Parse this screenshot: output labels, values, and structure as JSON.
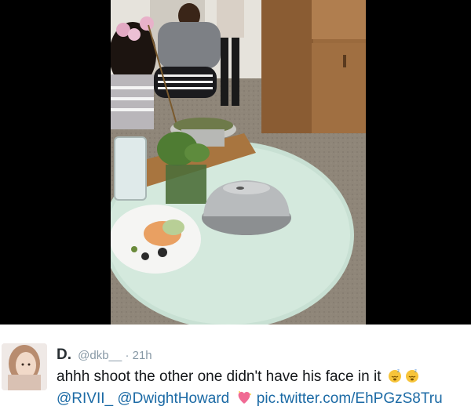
{
  "tweet": {
    "display_name": "D.",
    "handle": "@dkb__",
    "separator": "·",
    "time": "21h",
    "text": "ahhh shoot the other one didn't have his face in it",
    "text_emojis": [
      "sleeping-face-emoji",
      "sleeping-face-emoji"
    ],
    "mention_1": "@RIVII_",
    "mention_2": "@DwightHoward",
    "heart_emoji": "sparkling-heart-emoji",
    "media_link": "pic.twitter.com/EhPGzS8Tru"
  },
  "colors": {
    "link": "#1b6aa5",
    "text": "#14171a",
    "meta": "#8899a6",
    "background": "#000000"
  }
}
